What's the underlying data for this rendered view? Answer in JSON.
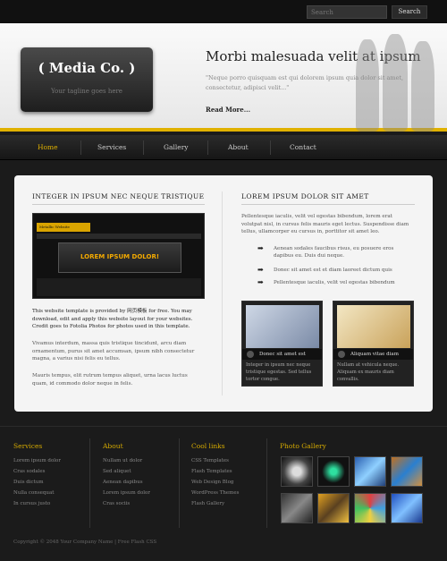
{
  "top": {
    "search_placeholder": "Search",
    "search_button": "Search"
  },
  "header": {
    "logo_title": "( Media Co. )",
    "logo_tagline": "Your tagline goes here",
    "hero_title": "Morbi malesuada velit at ipsum",
    "hero_text": "\"Neque porro quisquam est qui dolorem ipsum quia dolor sit amet, consectetur, adipisci velit...\"",
    "read_more": "Read More..."
  },
  "nav": {
    "items": [
      "Home",
      "Services",
      "Gallery",
      "About",
      "Contact"
    ],
    "active": "Home"
  },
  "left": {
    "heading": "Integer in ipsum nec neque tristique",
    "shot_site_title": "Metallic Website",
    "shot_headline": "LOREM IPSUM DOLOR!",
    "para1": "This website template is provided by 网页模板 for free. You may download, edit and apply this website layout for your websites. Credit goes to Fotolia Photos for photos used in this template.",
    "para2": "Vivamus interdum, massa quis tristique tincidunt, arcu diam ornamentum, purus sit amet accumsan, ipsum nibh consectetur magna, a varius nisi felis eu tellus.",
    "para3": "Mauris tempus, elit rutrum tempus aliquet, urna lacus luctus quam, id commodo dolor neque in felis."
  },
  "right": {
    "heading": "Lorem ipsum dolor sit amet",
    "intro": "Pellentesque iaculis, velit vel egestas bibendum, lorem erat volutpat nisl, in cursus felis mauris eget lectus. Suspendisse diam tellus, ullamcorper eu cursus in, porttitor sit amet leo.",
    "bullets": [
      "Aenean sodales faucibus risus, eu posuere eros dapibus eu. Duis dui neque.",
      "Donec sit amet est et diam laoreet dictum quis",
      "Pellentesque iaculis, velit vel egestas bibendum"
    ],
    "thumbs": [
      {
        "caption": "Donec sit amet est",
        "text": "Integer in ipsum nec neque tristique egestas. Sed tellus tortor congue."
      },
      {
        "caption": "Aliquam vitae diam",
        "text": "Nullam at vehicula neque. Aliquam ex mauris diam convallis."
      }
    ]
  },
  "footer": {
    "services": {
      "heading": "Services",
      "links": [
        "Lorem ipsum dolor",
        "Cras sodales",
        "Duis dictum",
        "Nulla consequat",
        "In cursus justo"
      ]
    },
    "about": {
      "heading": "About",
      "links": [
        "Nullam ut dolor",
        "Sed aliquet",
        "Aenean dapibus",
        "Lorem ipsum dolor",
        "Cras sociis"
      ]
    },
    "cool": {
      "heading": "Cool links",
      "links": [
        "CSS Templates",
        "Flash Templates",
        "Web Design Blog",
        "WordPress Themes",
        "Flash Gallery"
      ]
    },
    "gallery": {
      "heading": "Photo Gallery"
    },
    "copyright": "Copyright © 2048 Your Company Name | Free Flash CSS"
  }
}
